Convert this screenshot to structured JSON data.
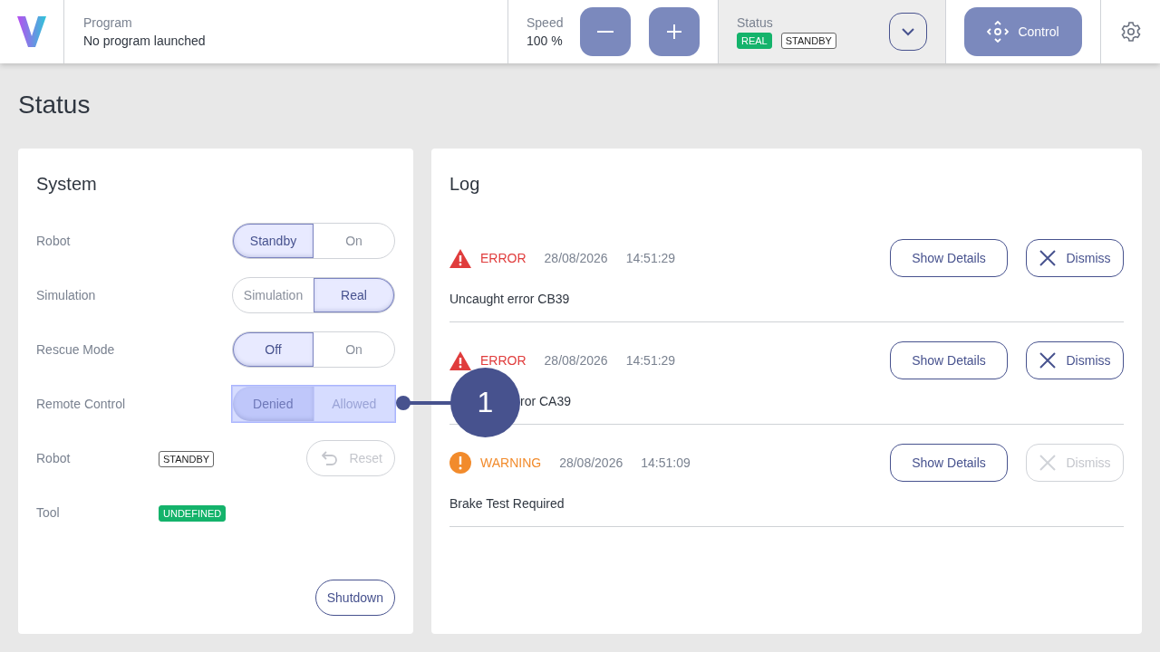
{
  "header": {
    "program": {
      "label": "Program",
      "value": "No program launched"
    },
    "speed": {
      "label": "Speed",
      "value": "100 %"
    },
    "status": {
      "label": "Status",
      "badges": [
        {
          "text": "REAL",
          "kind": "filled"
        },
        {
          "text": "STANDBY",
          "kind": "outline"
        }
      ]
    },
    "control_button": "Control"
  },
  "page_title": "Status",
  "system": {
    "title": "System",
    "rows": [
      {
        "kind": "toggle",
        "label": "Robot",
        "disabled": false,
        "highlighted": false,
        "options": [
          {
            "label": "Standby",
            "selected": true
          },
          {
            "label": "On",
            "selected": false
          }
        ]
      },
      {
        "kind": "toggle",
        "label": "Simulation",
        "disabled": false,
        "highlighted": false,
        "options": [
          {
            "label": "Simulation",
            "selected": false
          },
          {
            "label": "Real",
            "selected": true
          }
        ]
      },
      {
        "kind": "toggle",
        "label": "Rescue Mode",
        "disabled": false,
        "highlighted": false,
        "options": [
          {
            "label": "Off",
            "selected": true
          },
          {
            "label": "On",
            "selected": false
          }
        ]
      },
      {
        "kind": "toggle",
        "label": "Remote Control",
        "disabled": true,
        "highlighted": true,
        "options": [
          {
            "label": "Denied",
            "selected": true
          },
          {
            "label": "Allowed",
            "selected": false
          }
        ]
      },
      {
        "kind": "badge",
        "label": "Robot",
        "badge": {
          "text": "STANDBY",
          "kind": "outline"
        },
        "action": {
          "label": "Reset",
          "disabled": true
        }
      },
      {
        "kind": "badge",
        "label": "Tool",
        "badge": {
          "text": "UNDEFINED",
          "kind": "filled"
        }
      }
    ],
    "shutdown_button": "Shutdown"
  },
  "log": {
    "title": "Log",
    "entries": [
      {
        "kind": "error",
        "label": "ERROR",
        "date": "28/08/2026",
        "time": "14:51:29",
        "message": "Uncaught error CB39",
        "covered": false,
        "details_button": "Show Details",
        "dismiss": {
          "label": "Dismiss",
          "disabled": false
        }
      },
      {
        "kind": "error",
        "label": "ERROR",
        "date": "28/08/2026",
        "time": "14:51:29",
        "message": "ror CA39",
        "covered": true,
        "details_button": "Show Details",
        "dismiss": {
          "label": "Dismiss",
          "disabled": false
        }
      },
      {
        "kind": "warning",
        "label": "WARNING",
        "date": "28/08/2026",
        "time": "14:51:09",
        "message": "Brake Test Required",
        "covered": false,
        "details_button": "Show Details",
        "dismiss": {
          "label": "Dismiss",
          "disabled": true
        }
      }
    ]
  },
  "annotation": {
    "label": "1"
  }
}
